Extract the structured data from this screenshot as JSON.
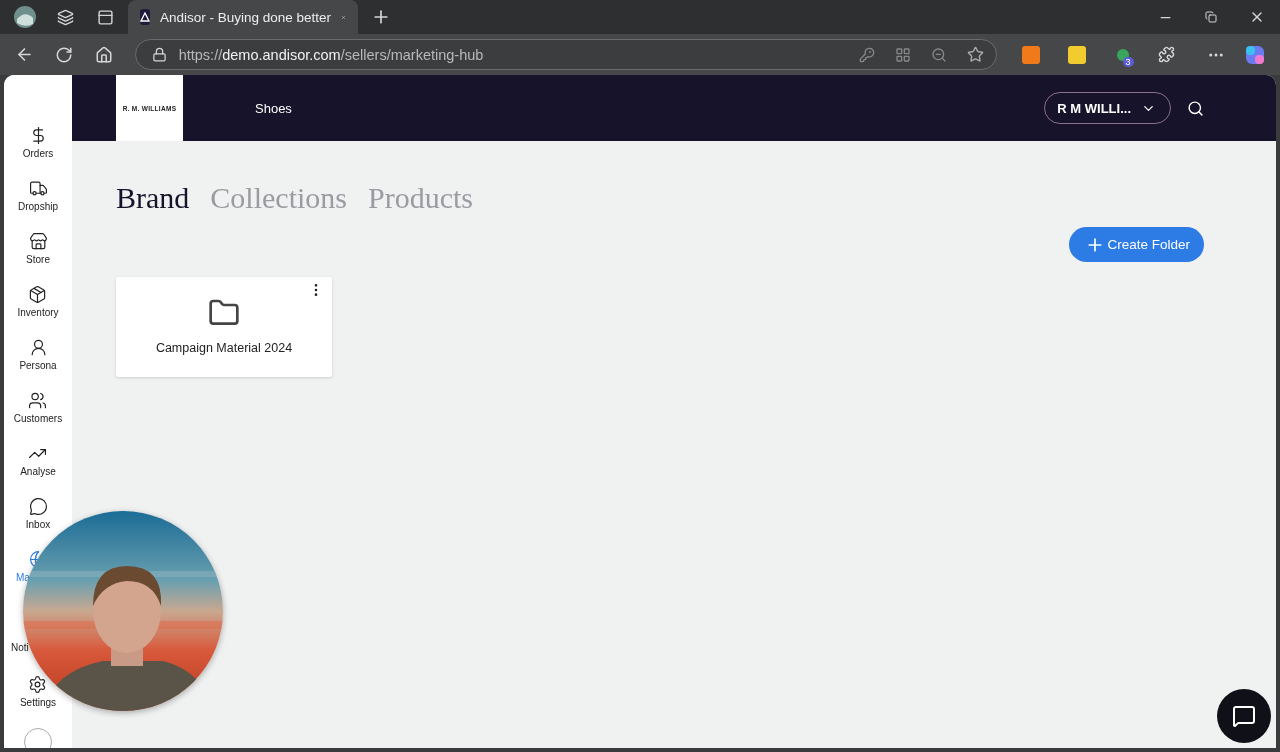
{
  "browser": {
    "tab_title": "Andisor - Buying done better",
    "url_scheme": "https://",
    "url_host": "demo.andisor.com",
    "url_path": "/sellers/marketing-hub",
    "extension_badge": "3"
  },
  "sidebar": {
    "items": [
      {
        "label": "Orders",
        "selected": false
      },
      {
        "label": "Dropship",
        "selected": false
      },
      {
        "label": "Store",
        "selected": false
      },
      {
        "label": "Inventory",
        "selected": false
      },
      {
        "label": "Persona",
        "selected": false
      },
      {
        "label": "Customers",
        "selected": false
      },
      {
        "label": "Analyse",
        "selected": false
      },
      {
        "label": "Inbox",
        "selected": false
      },
      {
        "label": "Ma",
        "selected": true,
        "kind": "cut"
      },
      {
        "label": "Noti",
        "selected": false,
        "kind": "label"
      },
      {
        "label": "Settings",
        "selected": false
      }
    ]
  },
  "header": {
    "logo_text": "R. M. WILLIAMS",
    "nav": "Shoes",
    "account": "R M WILLI..."
  },
  "tabs": [
    {
      "label": "Brand",
      "selected": true
    },
    {
      "label": "Collections",
      "selected": false
    },
    {
      "label": "Products",
      "selected": false
    }
  ],
  "create_button": "Create Folder",
  "folders": [
    {
      "name": "Campaign Material 2024"
    }
  ]
}
